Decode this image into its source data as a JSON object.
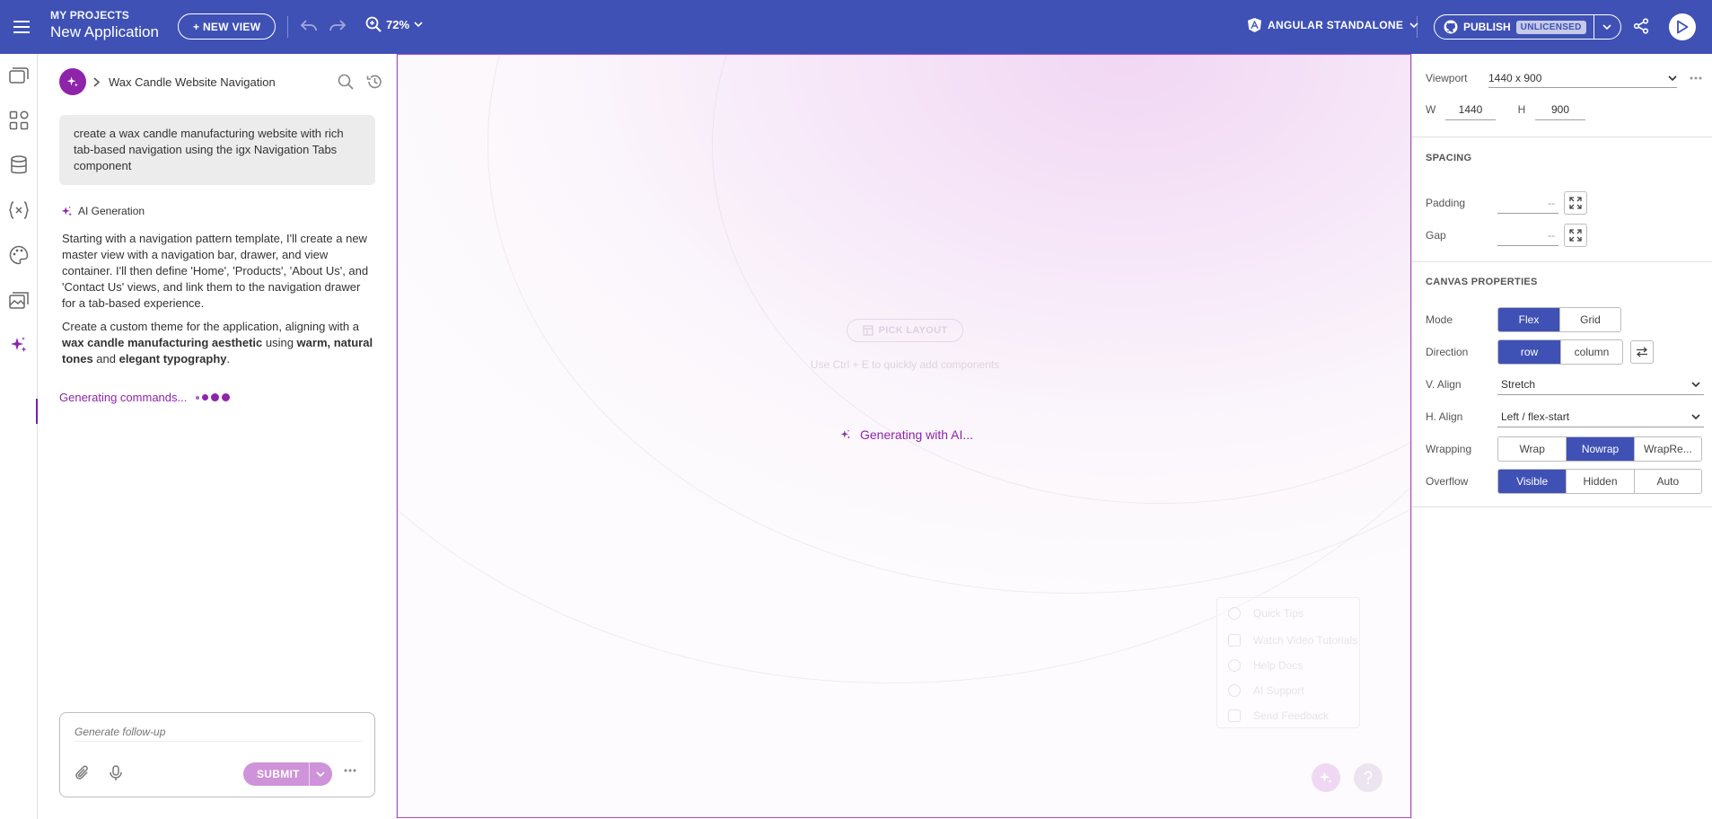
{
  "header": {
    "project_label": "MY PROJECTS",
    "app_name": "New Application",
    "new_view_label": "+ NEW VIEW",
    "zoom_value": "72%",
    "framework_label": "ANGULAR STANDALONE",
    "publish_label": "PUBLISH",
    "license_badge": "UNLICENSED",
    "brand_color": "#3f51b5"
  },
  "rail": {
    "items": [
      "views-icon",
      "components-icon",
      "data-icon",
      "variables-icon",
      "theme-icon",
      "assets-icon",
      "ai-sparkle-icon"
    ],
    "active": "ai-sparkle-icon"
  },
  "chat": {
    "title": "Wax Candle Website Navigation",
    "prompt": "create a wax candle manufacturing website with rich tab-based navigation using the igx Navigation Tabs component",
    "ai_label": "AI Generation",
    "para1": "Starting with a navigation pattern template, I'll create a new master view with a navigation bar, drawer, and view container. I'll then define 'Home', 'Products', 'About Us', and 'Contact Us' views, and link them to the navigation drawer for a tab-based experience.",
    "para2_a": "Create a custom theme for the application, aligning with a ",
    "para2_b": "wax candle manufacturing aesthetic",
    "para2_c": " using ",
    "para2_d": "warm, natural tones",
    "para2_e": " and ",
    "para2_f": "elegant typography",
    "para2_g": ".",
    "status": "Generating commands...",
    "input_placeholder": "Generate follow-up",
    "submit_label": "SUBMIT",
    "accent_color": "#8e24aa"
  },
  "canvas": {
    "pick_layout_label": "PICK LAYOUT",
    "hint": "Use Ctrl + E to quickly add components",
    "generating_label": "Generating with AI...",
    "help_items": [
      "Quick Tips",
      "Watch Video Tutorials",
      "Help Docs",
      "AI Support",
      "Send Feedback"
    ]
  },
  "props": {
    "viewport_label": "Viewport",
    "viewport_value": "1440 x 900",
    "w_label": "W",
    "w_value": "1440",
    "h_label": "H",
    "h_value": "900",
    "spacing_title": "SPACING",
    "padding_label": "Padding",
    "padding_value": "--",
    "gap_label": "Gap",
    "gap_value": "--",
    "canvas_title": "CANVAS PROPERTIES",
    "mode_label": "Mode",
    "mode_options": [
      "Flex",
      "Grid"
    ],
    "mode_selected": "Flex",
    "direction_label": "Direction",
    "direction_options": [
      "row",
      "column"
    ],
    "direction_selected": "row",
    "valign_label": "V. Align",
    "valign_value": "Stretch",
    "halign_label": "H. Align",
    "halign_value": "Left / flex-start",
    "wrapping_label": "Wrapping",
    "wrapping_options": [
      "Wrap",
      "Nowrap",
      "WrapRe..."
    ],
    "wrapping_selected": "Nowrap",
    "overflow_label": "Overflow",
    "overflow_options": [
      "Visible",
      "Hidden",
      "Auto"
    ],
    "overflow_selected": "Visible"
  }
}
